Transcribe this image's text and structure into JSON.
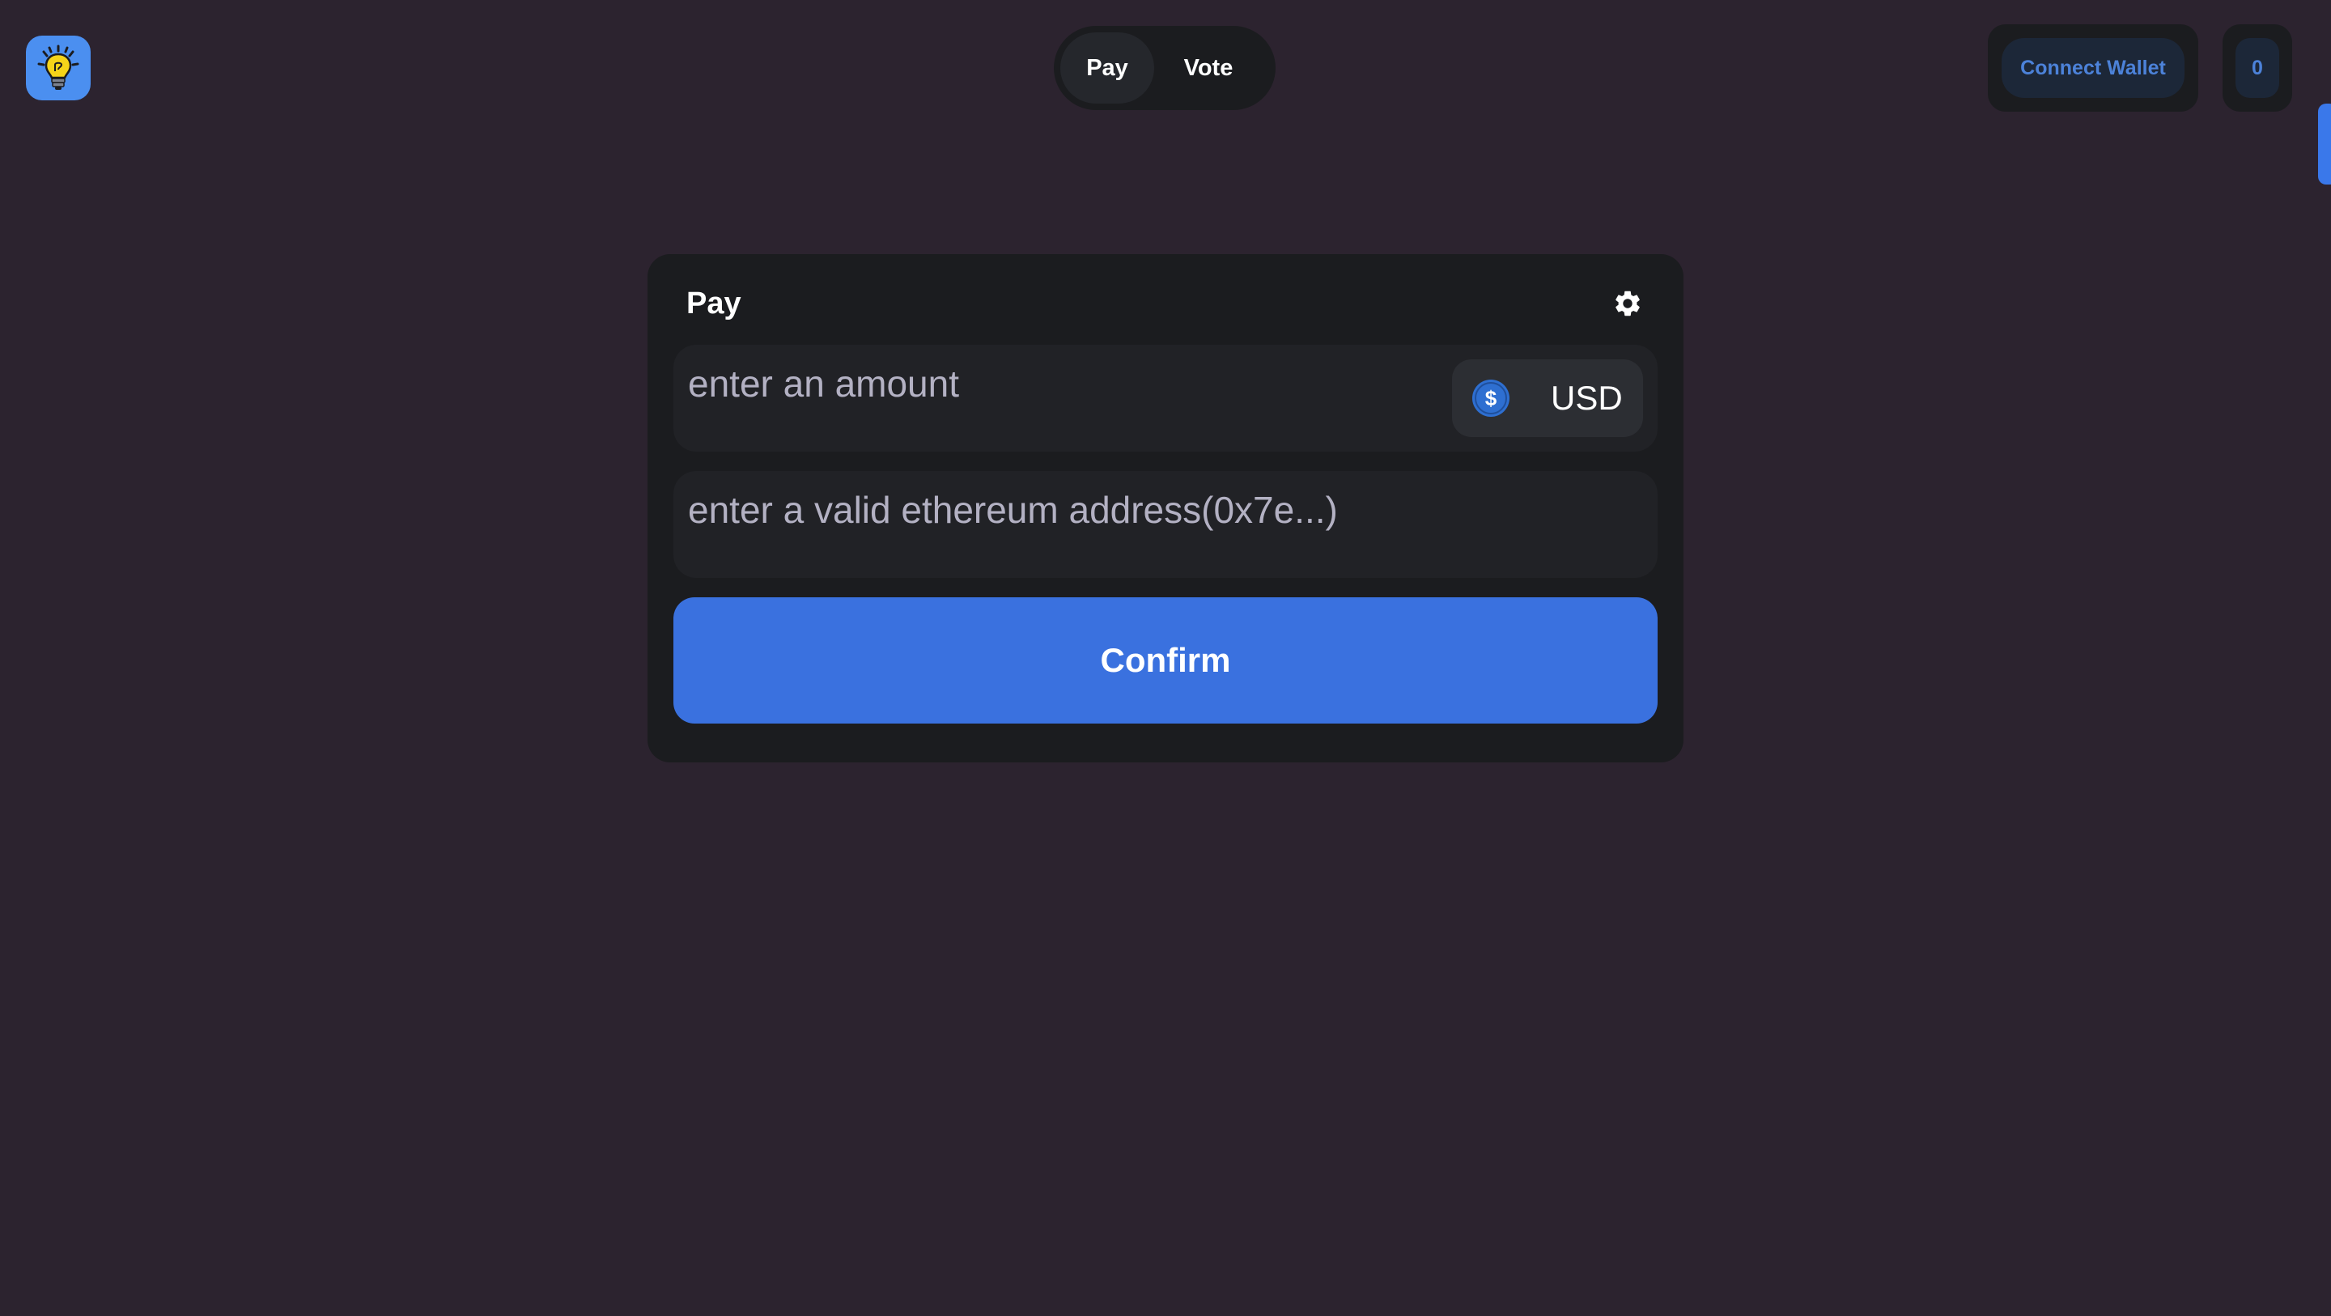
{
  "logo": {
    "icon": "lightbulb-icon",
    "background": "#4b8ff0"
  },
  "nav": {
    "tabs": [
      {
        "label": "Pay",
        "active": true
      },
      {
        "label": "Vote",
        "active": false
      }
    ]
  },
  "wallet": {
    "connect_label": "Connect Wallet",
    "count": "0"
  },
  "card": {
    "title": "Pay",
    "settings_icon": "gear-icon",
    "amount": {
      "value": "",
      "placeholder": "enter an amount",
      "currency": "USD",
      "currency_icon": "dollar-icon"
    },
    "address": {
      "value": "",
      "placeholder": "enter a valid ethereum address(0x7e...)"
    },
    "confirm_label": "Confirm"
  },
  "colors": {
    "background": "#2c232f",
    "card": "#1b1c1f",
    "accent": "#3a71df",
    "link": "#4c82d9"
  }
}
